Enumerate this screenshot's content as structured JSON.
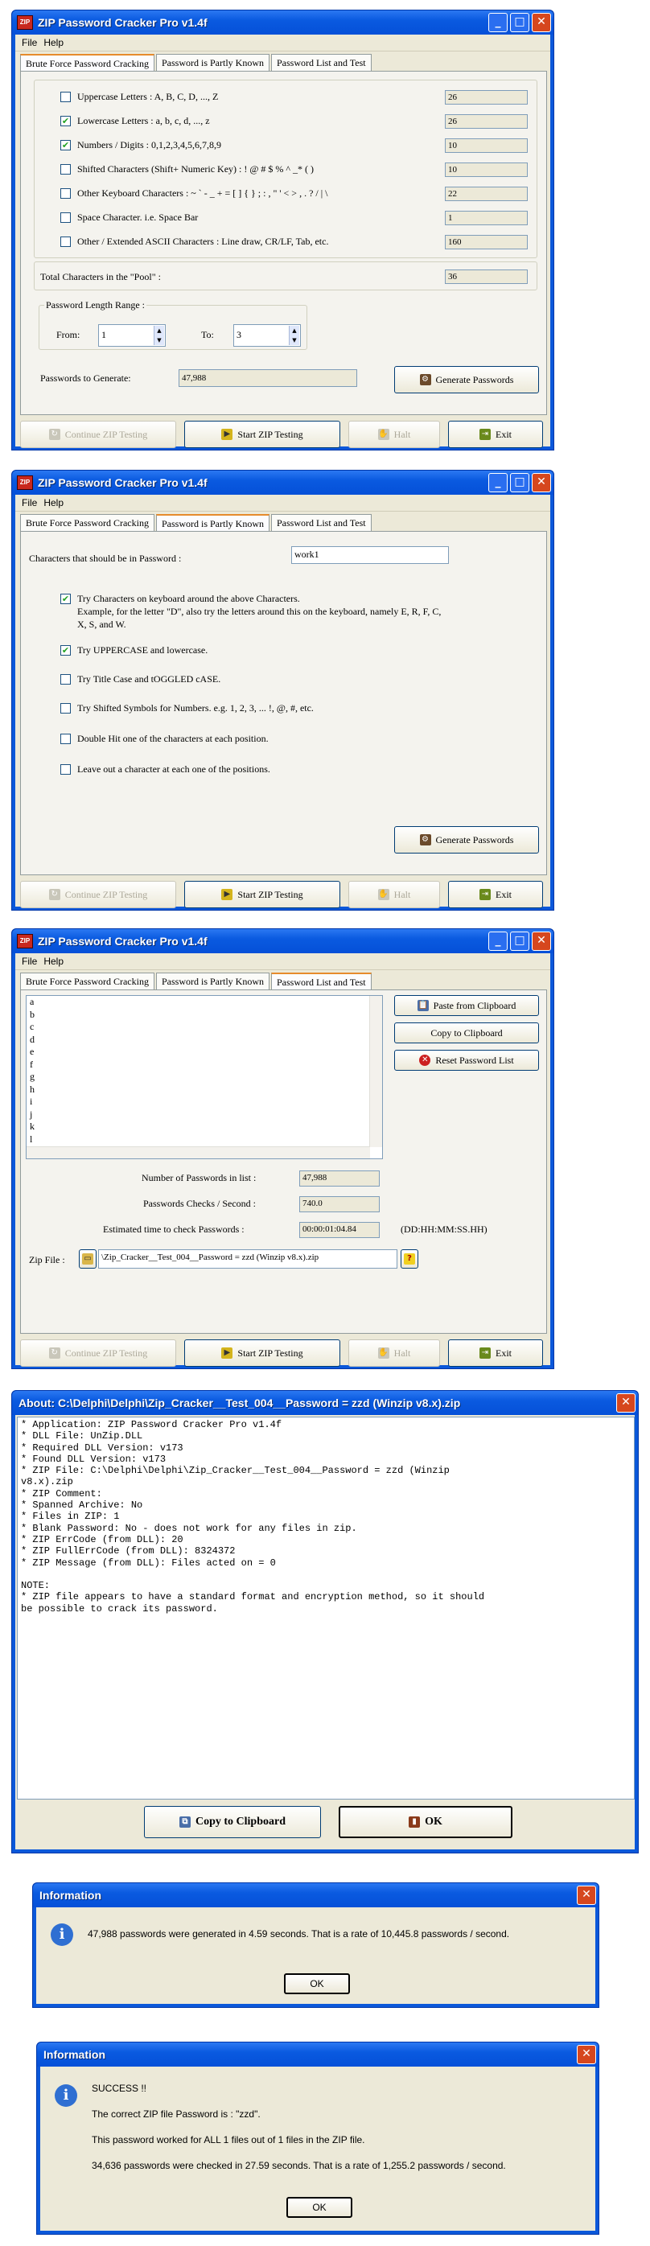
{
  "app_title": "ZIP Password Cracker Pro v1.4f",
  "menu": {
    "file": "File",
    "help": "Help"
  },
  "tabs": [
    "Brute Force Password Cracking",
    "Password is Partly Known",
    "Password List and Test"
  ],
  "bottom_buttons": {
    "continue": "Continue ZIP Testing",
    "start": "Start ZIP Testing",
    "halt": "Halt",
    "exit": "Exit"
  },
  "brute": {
    "charsets": [
      {
        "label": "Uppercase Letters : A, B, C, D, ..., Z",
        "checked": false,
        "count": "26"
      },
      {
        "label": "Lowercase Letters : a, b, c, d, ..., z",
        "checked": true,
        "count": "26"
      },
      {
        "label": "Numbers / Digits : 0,1,2,3,4,5,6,7,8,9",
        "checked": true,
        "count": "10"
      },
      {
        "label": "Shifted Characters (Shift+ Numeric Key) : ! @ # $ % ^ _* ( )",
        "checked": false,
        "count": "10"
      },
      {
        "label": "Other Keyboard Characters : ~ ` - _ + = [ ] { } ; : , \" ' < > , . ? / | \\",
        "checked": false,
        "count": "22"
      },
      {
        "label": "Space Character.  i.e. Space Bar",
        "checked": false,
        "count": "1"
      },
      {
        "label": "Other / Extended ASCII Characters : Line draw, CR/LF, Tab, etc.",
        "checked": false,
        "count": "160"
      }
    ],
    "pool_label": "Total Characters in the \"Pool\" :",
    "pool_value": "36",
    "length_group": "Password Length Range :",
    "from_label": "From:",
    "from_value": "1",
    "to_label": "To:",
    "to_value": "3",
    "generate_label": "Passwords to Generate:",
    "generate_value": "47,988",
    "generate_button": "Generate Passwords"
  },
  "partial": {
    "chars_label": "Characters that should be in Password :",
    "chars_value": "work1",
    "options": [
      {
        "label": "Try Characters on keyboard around the above Characters.",
        "extra": [
          "Example, for the letter \"D\", also try the letters around this on the keyboard, namely E, R, F, C,",
          "X, S, and W."
        ],
        "checked": true
      },
      {
        "label": "Try UPPERCASE and lowercase.",
        "checked": true
      },
      {
        "label": "Try  Title Case and tOGGLED cASE.",
        "checked": false
      },
      {
        "label": "Try Shifted Symbols for Numbers.  e.g. 1, 2, 3, ... !, @, #, etc.",
        "checked": false
      },
      {
        "label": "Double Hit one of the characters at each position.",
        "checked": false
      },
      {
        "label": "Leave out a character at each one of the positions.",
        "checked": false
      }
    ],
    "generate_button": "Generate Passwords"
  },
  "list": {
    "items": [
      "a",
      "b",
      "c",
      "d",
      "e",
      "f",
      "g",
      "h",
      "i",
      "j",
      "k",
      "l"
    ],
    "paste_button": "Paste from Clipboard",
    "copy_button": "Copy to Clipboard",
    "reset_button": "Reset Password List",
    "num_label": "Number of Passwords in list :",
    "num_value": "47,988",
    "rate_label": "Passwords Checks / Second :",
    "rate_value": "740.0",
    "eta_label": "Estimated time to check Passwords :",
    "eta_value": "00:00:01:04.84",
    "eta_format": "(DD:HH:MM:SS.HH)",
    "zip_label": "Zip File :",
    "zip_value": "\\Zip_Cracker__Test_004__Password = zzd (Winzip v8.x).zip",
    "help_icon": "?"
  },
  "about": {
    "title": "About: C:\\Delphi\\Delphi\\Zip_Cracker__Test_004__Password = zzd (Winzip v8.x).zip",
    "text": "* Application: ZIP Password Cracker Pro v1.4f\n* DLL File: UnZip.DLL\n* Required DLL Version: v173\n* Found DLL Version: v173\n* ZIP File: C:\\Delphi\\Delphi\\Zip_Cracker__Test_004__Password = zzd (Winzip\nv8.x).zip\n* ZIP Comment:\n* Spanned Archive: No\n* Files in ZIP: 1\n* Blank Password: No - does not work for any files in zip.\n* ZIP ErrCode (from DLL): 20\n* ZIP FullErrCode (from DLL): 8324372\n* ZIP Message (from DLL): Files acted on = 0\n\nNOTE:\n* ZIP file appears to have a standard format and encryption method, so it should\nbe possible to crack its password.",
    "copy_button": "Copy to Clipboard",
    "ok_button": "OK"
  },
  "info1": {
    "title": "Information",
    "message": "47,988 passwords were generated in 4.59 seconds.  That is a rate of 10,445.8 passwords / second.",
    "ok": "OK"
  },
  "info2": {
    "title": "Information",
    "lines": [
      "SUCCESS !!",
      "The correct ZIP file Password is : \"zzd\".",
      "This password worked for ALL 1 files out of 1 files in the ZIP file.",
      "34,636 passwords were checked in 27.59 seconds.  That is a rate of 1,255.2 passwords / second."
    ],
    "ok": "OK"
  }
}
